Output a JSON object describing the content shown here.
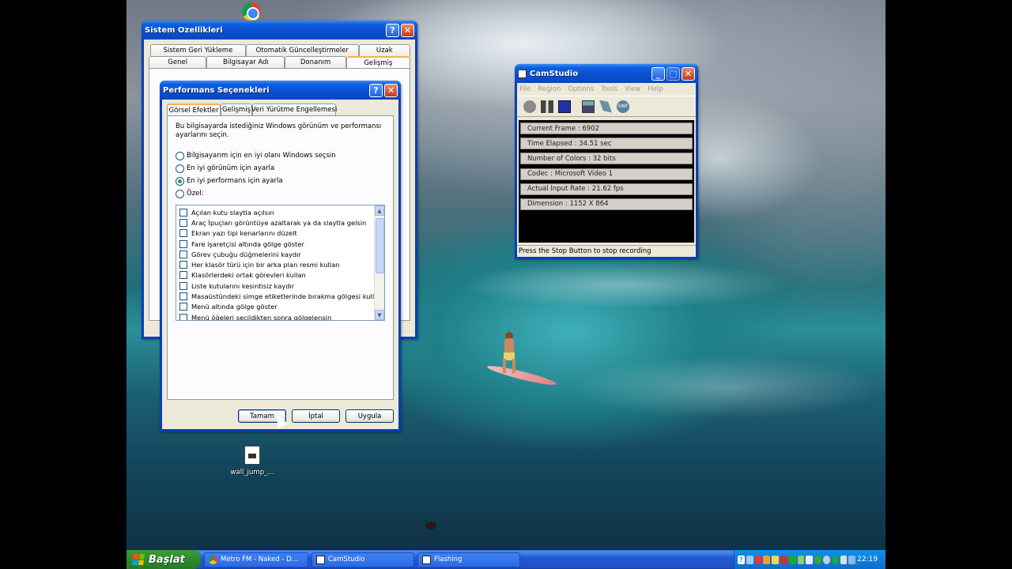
{
  "system_properties": {
    "title": "Sistem Özellikleri",
    "tabs_row1": [
      "Sistem Geri Yükleme",
      "Otomatik Güncelleştirmeler",
      "Uzak"
    ],
    "tabs_row2": [
      "Genel",
      "Bilgisayar Adı",
      "Donanım",
      "Gelişmiş"
    ]
  },
  "performance_options": {
    "title": "Performans Seçenekleri",
    "tabs": [
      "Görsel Efektler",
      "Gelişmiş",
      "Veri Yürütme Engellemesi"
    ],
    "description": "Bu bilgisayarda istediğiniz Windows görünüm ve performansı ayarlarını seçin.",
    "radio_options": [
      "Bilgisayarım için en iyi olanı Windows seçsin",
      "En iyi görünüm için ayarla",
      "En iyi performans için ayarla",
      "Özel:"
    ],
    "selected_radio": 2,
    "effects": [
      "Açılan kutu slaytla açılsın",
      "Araç İpuçları görüntüye azaltarak ya da slaytla gelsin",
      "Ekran yazı tipi kenarlarını düzelt",
      "Fare işaretçisi altında gölge göster",
      "Görev çubuğu düğmelerini kaydır",
      "Her klasör türü için bir arka plan resmi kullan",
      "Klasörlerdeki ortak görevleri kullan",
      "Liste kutularını kesintisiz kaydır",
      "Masaüstündeki simge etiketlerinde bırakma gölgesi kullan",
      "Menü altında gölge göster",
      "Menü öğeleri seçildikten sonra gölgelensin"
    ],
    "buttons": {
      "ok": "Tamam",
      "cancel": "İptal",
      "apply": "Uygula"
    }
  },
  "camstudio": {
    "title": "CamStudio",
    "menu": [
      "File",
      "Region",
      "Options",
      "Tools",
      "View",
      "Help"
    ],
    "stats": [
      "Current Frame : 6902",
      "Time Elapsed : 34.51 sec",
      "Number of Colors : 32 bits",
      "Codec : Microsoft Video 1",
      "Actual Input Rate : 21.62 fps",
      "Dimension : 1152 X 864"
    ],
    "status": "Press the Stop Button to stop recording"
  },
  "desktop": {
    "file_icon_label": "wall_jump_..."
  },
  "taskbar": {
    "start_label": "Başlat",
    "buttons": [
      "Metro FM - Naked - D...",
      "CamStudio",
      "Flashing"
    ],
    "clock": "22:19"
  }
}
